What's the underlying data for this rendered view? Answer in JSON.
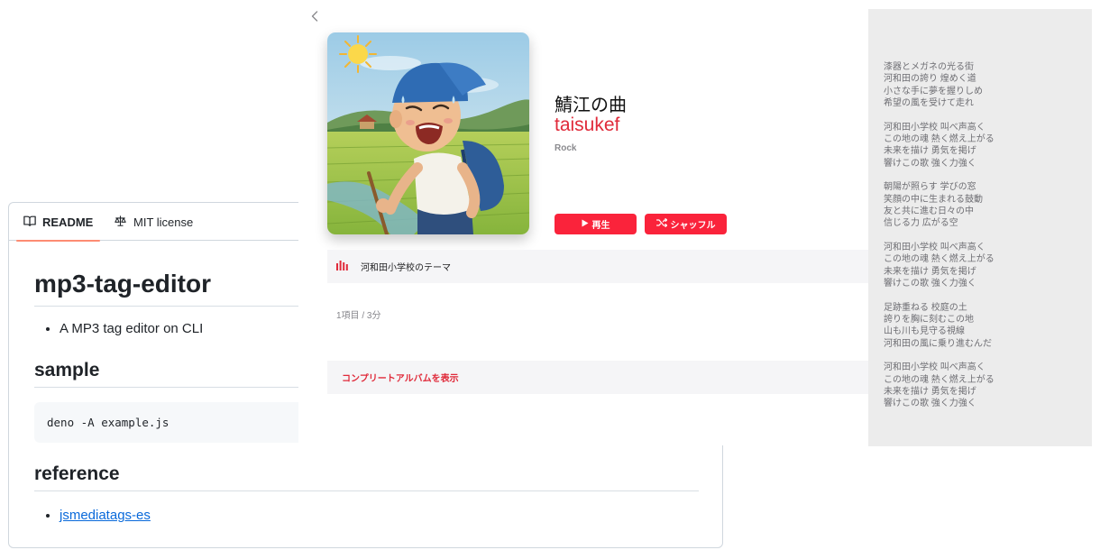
{
  "github": {
    "tabs": [
      {
        "label": "README",
        "icon": "book-icon",
        "active": true
      },
      {
        "label": "MIT license",
        "icon": "scale-icon",
        "active": false
      }
    ],
    "title": "mp3-tag-editor",
    "intro_items": [
      "A MP3 tag editor on CLI"
    ],
    "sample_heading": "sample",
    "code": "deno -A example.js",
    "reference_heading": "reference",
    "reference_links": [
      "jsmediatags-es"
    ],
    "colors": {
      "tab_underline": "#fd8c73",
      "link": "#0969da"
    }
  },
  "music": {
    "back_icon": "chevron-left-icon",
    "album_title": "鯖江の曲",
    "artist": "taisukef",
    "genre": "Rock",
    "play_label": "再生",
    "shuffle_label": "シャッフル",
    "tracks": [
      {
        "title": "河和田小学校のテーマ",
        "now_playing": true
      }
    ],
    "summary": "1項目 / 3分",
    "complete_album_label": "コンプリートアルバムを表示",
    "colors": {
      "accent": "#fa233b",
      "artist": "#e02a3a"
    }
  },
  "lyrics": [
    [
      "漆器とメガネの光る街",
      "河和田の誇り 煌めく道",
      "小さな手に夢を握りしめ",
      "希望の風を受けて走れ"
    ],
    [
      "河和田小学校 叫べ声高く",
      "この地の魂 熱く燃え上がる",
      "未来を描け 勇気を掲げ",
      "響けこの歌 強く力強く"
    ],
    [
      "朝陽が照らす 学びの窓",
      "笑顔の中に生まれる鼓動",
      "友と共に進む日々の中",
      "信じる力 広がる空"
    ],
    [
      "河和田小学校 叫べ声高く",
      "この地の魂 熱く燃え上がる",
      "未来を描け 勇気を掲げ",
      "響けこの歌 強く力強く"
    ],
    [
      "足跡重ねる 校庭の土",
      "誇りを胸に刻むこの地",
      "山も川も見守る視線",
      "河和田の風に乗り進むんだ"
    ],
    [
      "河和田小学校 叫べ声高く",
      "この地の魂 熱く燃え上がる",
      "未来を描け 勇気を掲げ",
      "響けこの歌 強く力強く"
    ]
  ]
}
